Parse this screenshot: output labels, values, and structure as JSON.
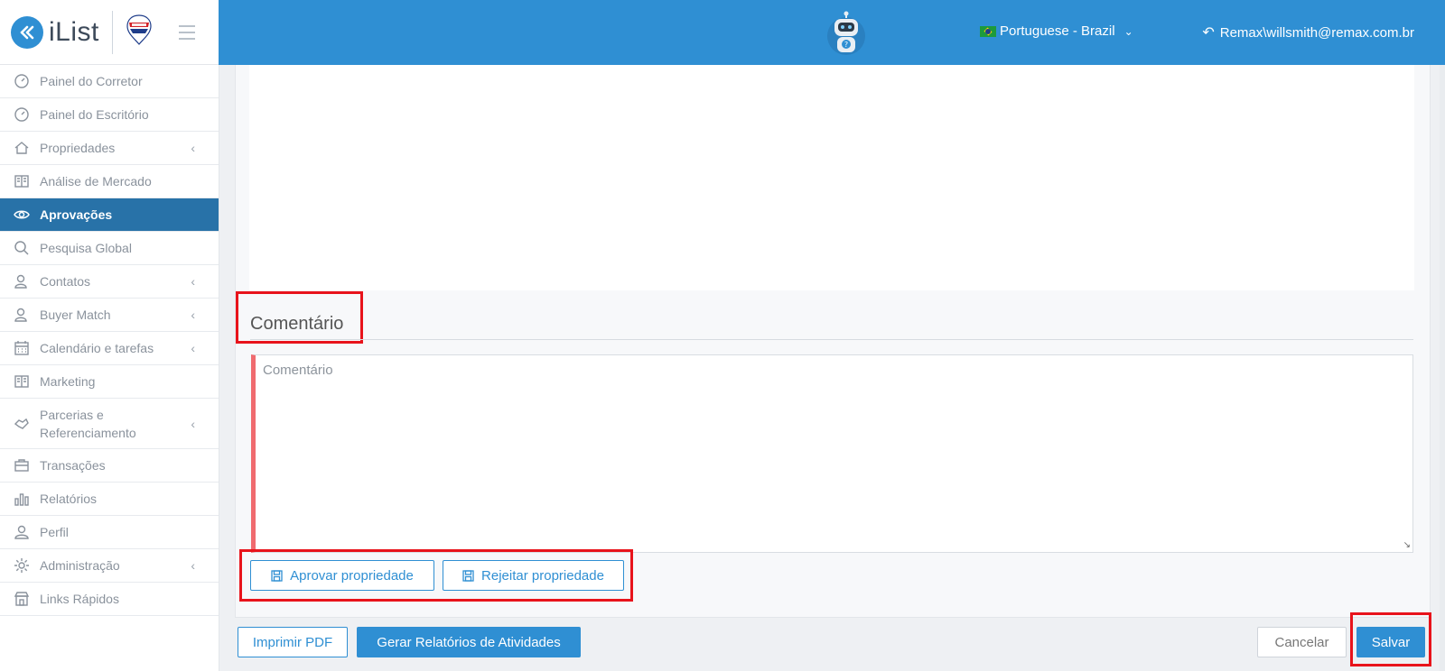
{
  "brand": {
    "name": "iList",
    "partner_logo": "remax-balloon-logo"
  },
  "header": {
    "language": "Portuguese - Brazil",
    "user": "Remax\\willsmith@remax.com.br",
    "help_bot": "robot-help-icon"
  },
  "sidebar": {
    "items": [
      {
        "label": "Painel do Corretor",
        "icon": "gauge-icon",
        "submenu": false
      },
      {
        "label": "Painel do Escritório",
        "icon": "gauge-icon",
        "submenu": false
      },
      {
        "label": "Propriedades",
        "icon": "home-icon",
        "submenu": true
      },
      {
        "label": "Análise de Mercado",
        "icon": "book-icon",
        "submenu": false
      },
      {
        "label": "Aprovações",
        "icon": "eye-icon",
        "submenu": false,
        "active": true
      },
      {
        "label": "Pesquisa Global",
        "icon": "search-icon",
        "submenu": false
      },
      {
        "label": "Contatos",
        "icon": "contacts-icon",
        "submenu": true
      },
      {
        "label": "Buyer Match",
        "icon": "users-icon",
        "submenu": true
      },
      {
        "label": "Calendário e tarefas",
        "icon": "calendar-icon",
        "submenu": true
      },
      {
        "label": "Marketing",
        "icon": "book-icon",
        "submenu": false
      },
      {
        "label": "Parcerias e Referenciamento",
        "icon": "handshake-icon",
        "submenu": true
      },
      {
        "label": "Transações",
        "icon": "briefcase-icon",
        "submenu": false
      },
      {
        "label": "Relatórios",
        "icon": "bar-chart-icon",
        "submenu": false
      },
      {
        "label": "Perfil",
        "icon": "user-icon",
        "submenu": false
      },
      {
        "label": "Administração",
        "icon": "gear-icon",
        "submenu": true
      },
      {
        "label": "Links Rápidos",
        "icon": "store-icon",
        "submenu": false
      }
    ]
  },
  "comment": {
    "section_title": "Comentário",
    "placeholder": "Comentário",
    "value": ""
  },
  "actions": {
    "approve": "Aprovar propriedade",
    "reject": "Rejeitar propriedade",
    "print_pdf": "Imprimir PDF",
    "activity_report": "Gerar Relatórios de Atividades",
    "cancel": "Cancelar",
    "save": "Salvar"
  },
  "colors": {
    "primary": "#2f8fd3",
    "active_nav": "#2872a8",
    "highlight": "#e8131b",
    "required_bar": "#f06b6f"
  }
}
